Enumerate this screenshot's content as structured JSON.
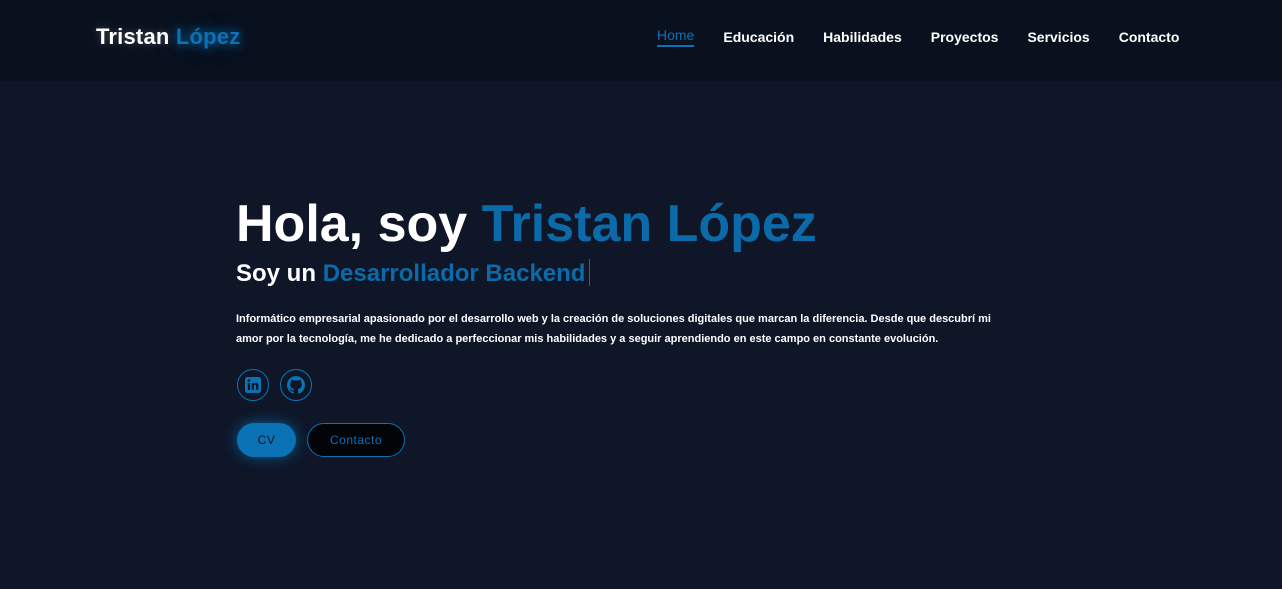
{
  "brand": {
    "first": "Tristan",
    "last": "López"
  },
  "nav": {
    "items": [
      {
        "label": "Home"
      },
      {
        "label": "Educación"
      },
      {
        "label": "Habilidades"
      },
      {
        "label": "Proyectos"
      },
      {
        "label": "Servicios"
      },
      {
        "label": "Contacto"
      }
    ],
    "active": "Home"
  },
  "hero": {
    "greeting": "Hola, soy",
    "name": "Tristan López",
    "role_prefix": "Soy un",
    "role": "Desarrollador Backend",
    "intro": "Informático empresarial apasionado por el desarrollo web y la creación de soluciones digitales que marcan la diferencia. Desde que descubrí mi amor por la tecnología, me he dedicado a perfeccionar mis habilidades y a seguir aprendiendo en este campo en constante evolución."
  },
  "socials": [
    {
      "icon": "linkedin-icon"
    },
    {
      "icon": "github-icon"
    }
  ],
  "buttons": {
    "cv_label": "CV",
    "contact_label": "Contacto"
  },
  "colors": {
    "accent": "#0b73b5",
    "background": "#0e1628",
    "header": "#0a111e"
  }
}
